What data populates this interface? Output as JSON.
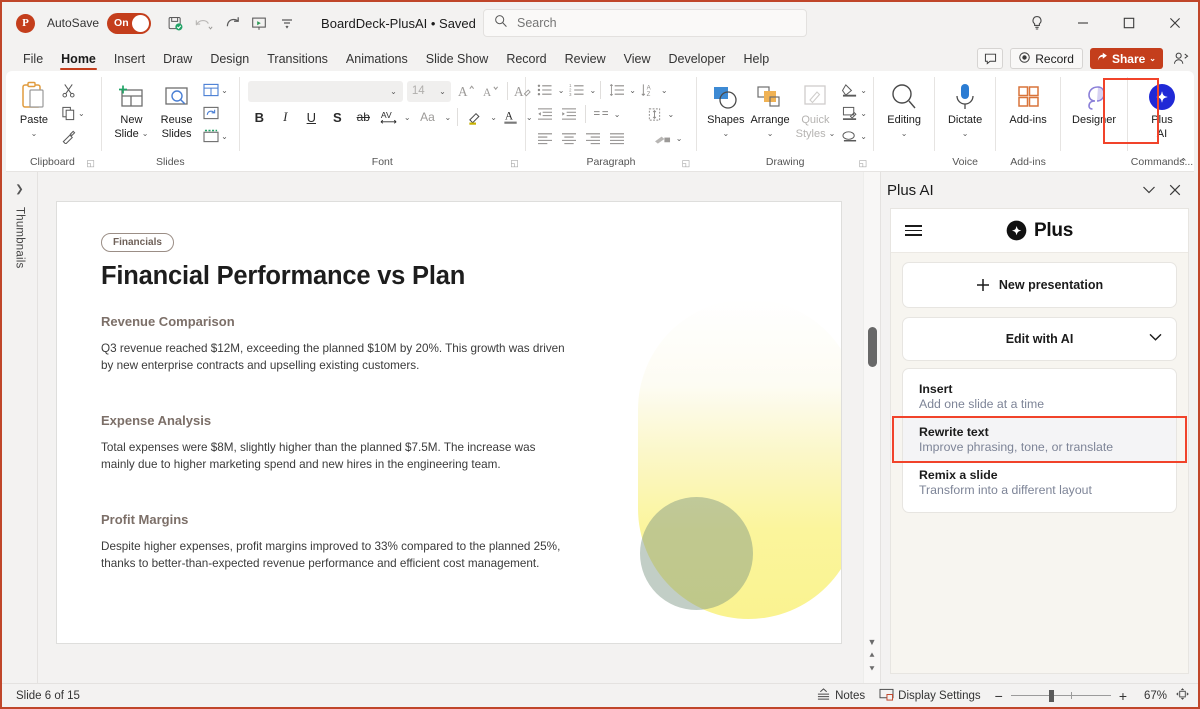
{
  "titlebar": {
    "app_logo": "powerpoint-logo",
    "autosave_label": "AutoSave",
    "autosave_state": "On",
    "document_title": "BoardDeck-PlusAI • Saved",
    "quick_access": [
      "save-icon",
      "undo-icon",
      "redo-icon",
      "present-icon",
      "customize-qat-icon"
    ],
    "window_controls": [
      "help-bulb-icon",
      "minimize-icon",
      "maximize-icon",
      "close-icon"
    ]
  },
  "search": {
    "placeholder": "Search",
    "value": ""
  },
  "ribbon_tabs": {
    "items": [
      {
        "label": "File",
        "active": false
      },
      {
        "label": "Home",
        "active": true
      },
      {
        "label": "Insert",
        "active": false
      },
      {
        "label": "Draw",
        "active": false
      },
      {
        "label": "Design",
        "active": false
      },
      {
        "label": "Transitions",
        "active": false
      },
      {
        "label": "Animations",
        "active": false
      },
      {
        "label": "Slide Show",
        "active": false
      },
      {
        "label": "Record",
        "active": false
      },
      {
        "label": "Review",
        "active": false
      },
      {
        "label": "View",
        "active": false
      },
      {
        "label": "Developer",
        "active": false
      },
      {
        "label": "Help",
        "active": false
      }
    ],
    "right_actions": {
      "comments_label": "comments-icon",
      "record_label": "Record",
      "share_label": "Share",
      "share_color": "#c43e1c",
      "person_label": "share-people-icon"
    }
  },
  "ribbon": {
    "groups": [
      {
        "name": "Clipboard",
        "label": "Clipboard",
        "big": {
          "label_line1": "Paste",
          "label_line2": ""
        },
        "small": [
          "cut-icon",
          "copy-icon",
          "format-painter-icon"
        ]
      },
      {
        "name": "Slides",
        "label": "Slides",
        "buttons": [
          {
            "line1": "New",
            "line2": "Slide"
          },
          {
            "line1": "Reuse",
            "line2": "Slides"
          }
        ],
        "small": [
          "layout-icon",
          "reset-icon",
          "section-icon"
        ]
      },
      {
        "name": "Font",
        "label": "Font",
        "font_name": "",
        "font_size": "14",
        "buttons": [
          "B",
          "I",
          "U",
          "S",
          "ab",
          "AV",
          "Aa",
          "text-highlight-icon",
          "font-color-icon"
        ],
        "grow_label": "A",
        "shrink_label": "A",
        "clear_label": "A"
      },
      {
        "name": "Paragraph",
        "label": "Paragraph",
        "buttons": [
          "bullets-icon",
          "numbering-icon",
          "line-spacing-icon",
          "sort-icon",
          "decrease-indent-icon",
          "increase-indent-icon",
          "columns-icon",
          "text-direction-icon",
          "align-left-icon",
          "align-center-icon",
          "align-right-icon",
          "justify-icon",
          "convert-smartart-icon"
        ]
      },
      {
        "name": "Drawing",
        "label": "Drawing",
        "buttons": [
          {
            "line1": "Shapes",
            "line2": ""
          },
          {
            "line1": "Arrange",
            "line2": ""
          },
          {
            "line1": "Quick",
            "line2": "Styles",
            "disabled": true
          }
        ],
        "small": [
          "shape-fill-icon",
          "shape-outline-icon",
          "shape-effects-icon"
        ]
      },
      {
        "name": "Editing",
        "label": "",
        "buttons": [
          {
            "line1": "Editing",
            "line2": ""
          }
        ]
      },
      {
        "name": "Voice",
        "label": "Voice",
        "buttons": [
          {
            "line1": "Dictate",
            "line2": ""
          }
        ]
      },
      {
        "name": "Add-ins",
        "label": "Add-ins",
        "buttons": [
          {
            "line1": "Add-ins",
            "line2": ""
          }
        ]
      },
      {
        "name": "Designer",
        "label": "",
        "buttons": [
          {
            "line1": "Designer",
            "line2": ""
          }
        ]
      },
      {
        "name": "Commands",
        "label": "Commands...",
        "buttons": [
          {
            "line1": "Plus",
            "line2": "AI"
          }
        ],
        "highlighted": true,
        "highlight_color": "#f1432a"
      }
    ]
  },
  "thumbnails_rail": {
    "label": "Thumbnails",
    "expand_icon": "chevron-right-icon"
  },
  "slide": {
    "tag": "Financials",
    "title": "Financial Performance vs Plan",
    "sections": [
      {
        "heading": "Revenue Comparison",
        "body": "Q3 revenue reached $12M, exceeding the planned $10M by 20%. This growth was driven by new enterprise contracts and upselling existing customers."
      },
      {
        "heading": "Expense Analysis",
        "body": "Total expenses were $8M, slightly higher than the planned $7.5M. The increase was mainly due to higher marketing spend and new hires in the engineering team."
      },
      {
        "heading": "Profit Margins",
        "body": "Despite higher expenses, profit margins improved to 33% compared to the planned 25%, thanks to better-than-expected revenue performance and efficient cost management."
      }
    ],
    "decor": {
      "oval_gradient_top": "#ffffff",
      "oval_gradient_bottom": "#faf390",
      "circle_color": "rgba(120,146,128,0.45)"
    }
  },
  "panel": {
    "title": "Plus AI",
    "collapse_icon": "chevron-down-icon",
    "close_icon": "close-icon",
    "brand": "Plus",
    "menu_icon": "hamburger-icon",
    "new_presentation": "New presentation",
    "edit_with_ai": "Edit with AI",
    "items": [
      {
        "title": "Insert",
        "subtitle": "Add one slide at a time",
        "selected": false
      },
      {
        "title": "Rewrite text",
        "subtitle": "Improve phrasing, tone, or translate",
        "selected": true
      },
      {
        "title": "Remix a slide",
        "subtitle": "Transform into a different layout",
        "selected": false
      }
    ],
    "highlight_color": "#f1432a"
  },
  "statusbar": {
    "slide_counter": "Slide 6 of 15",
    "notes_label": "Notes",
    "display_settings_label": "Display Settings",
    "zoom_out": "−",
    "zoom_in": "+",
    "zoom_value": "67%",
    "fit_icon": "fit-slide-icon"
  }
}
